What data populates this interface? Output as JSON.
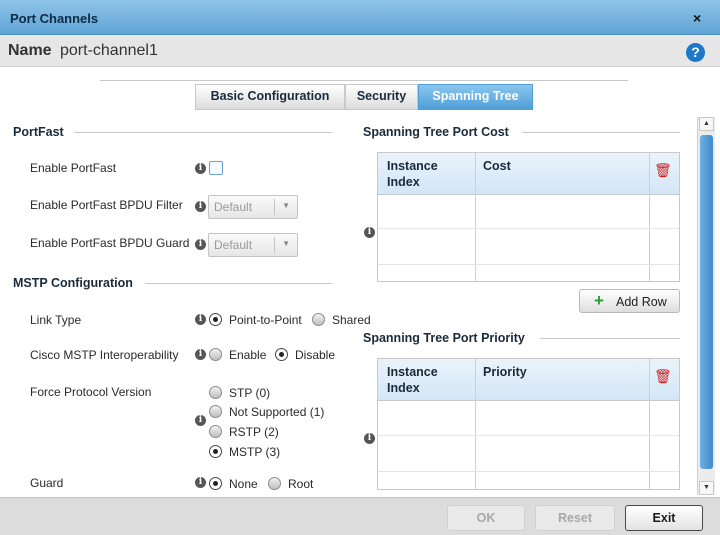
{
  "window": {
    "title": "Port Channels",
    "close_glyph": "×"
  },
  "header": {
    "name_label": "Name",
    "name_value": "port-channel1",
    "help_glyph": "?"
  },
  "tabs": [
    {
      "label": "Basic Configuration",
      "active": false
    },
    {
      "label": "Security",
      "active": false
    },
    {
      "label": "Spanning Tree",
      "active": true
    }
  ],
  "portfast": {
    "title": "PortFast",
    "enable_label": "Enable PortFast",
    "enable_checked": false,
    "bpdu_filter_label": "Enable PortFast BPDU Filter",
    "bpdu_filter_value": "Default",
    "bpdu_guard_label": "Enable PortFast BPDU Guard",
    "bpdu_guard_value": "Default"
  },
  "mstp": {
    "title": "MSTP Configuration",
    "link_type_label": "Link Type",
    "link_type_options": [
      "Point-to-Point",
      "Shared"
    ],
    "link_type_selected": "Point-to-Point",
    "cisco_label": "Cisco MSTP Interoperability",
    "cisco_options": [
      "Enable",
      "Disable"
    ],
    "cisco_selected": "Disable",
    "force_label": "Force Protocol Version",
    "force_options": [
      "STP (0)",
      "Not Supported (1)",
      "RSTP (2)",
      "MSTP (3)"
    ],
    "force_selected": "MSTP (3)",
    "guard_label": "Guard",
    "guard_options": [
      "None",
      "Root"
    ],
    "guard_selected": "None"
  },
  "port_cost": {
    "title": "Spanning Tree Port Cost",
    "columns": [
      "Instance Index",
      "Cost"
    ],
    "rows": [],
    "add_row_label": "Add Row"
  },
  "port_priority": {
    "title": "Spanning Tree Port Priority",
    "columns": [
      "Instance Index",
      "Priority"
    ],
    "rows": []
  },
  "footer": {
    "ok_label": "OK",
    "reset_label": "Reset",
    "exit_label": "Exit"
  },
  "icons": {
    "info": "info-icon",
    "trash": "trash-icon",
    "add": "plus-icon",
    "checkbox_color": "#6a9fd4",
    "accent": "#4f9fd9",
    "trash_color": "#cc2020",
    "add_color": "#2f9a2f"
  }
}
